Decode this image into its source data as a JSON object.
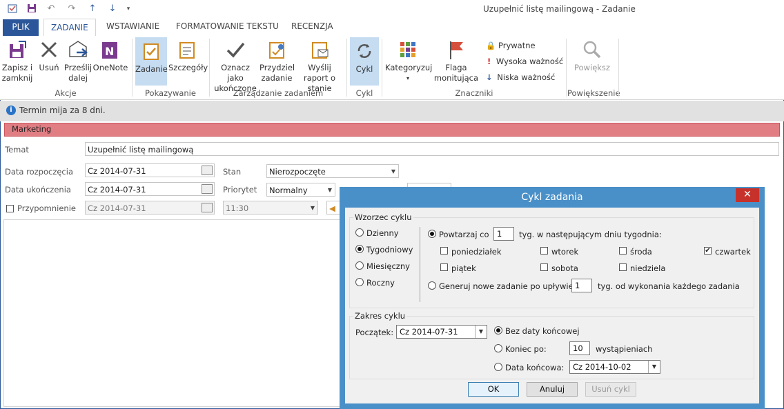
{
  "window": {
    "title": "Uzupełnić listę mailingową - Zadanie"
  },
  "tabs": [
    {
      "label": "PLIK"
    },
    {
      "label": "ZADANIE"
    },
    {
      "label": "WSTAWIANIE"
    },
    {
      "label": "FORMATOWANIE TEKSTU"
    },
    {
      "label": "RECENZJA"
    }
  ],
  "ribbon": {
    "save_close": "Zapisz i zamknij",
    "delete": "Usuń",
    "forward": "Prześlij dalej",
    "onenote": "OneNote",
    "group_actions": "Akcje",
    "task": "Zadanie",
    "details": "Szczegóły",
    "group_show": "Pokazywanie",
    "mark_complete": "Oznacz jako ukończone",
    "assign_task": "Przydziel zadanie",
    "send_status": "Wyślij raport o stanie",
    "group_manage": "Zarządzanie zadaniem",
    "recurrence": "Cykl",
    "group_recurrence": "Cykl",
    "categorize": "Kategoryzuj",
    "follow_up": "Flaga monitująca",
    "private": "Prywatne",
    "high_importance": "Wysoka ważność",
    "low_importance": "Niska ważność",
    "group_tags": "Znaczniki",
    "zoom": "Powiększ",
    "group_zoom": "Powiększenie"
  },
  "infobar": {
    "text": "Termin mija za 8 dni."
  },
  "category": {
    "label": "Marketing",
    "color": "#e17e84"
  },
  "form": {
    "subject_label": "Temat",
    "subject_value": "Uzupełnić listę mailingową",
    "start_label": "Data rozpoczęcia",
    "start_value": "Cz 2014-07-31",
    "due_label": "Data ukończenia",
    "due_value": "Cz 2014-07-31",
    "reminder_label": "Przypomnienie",
    "reminder_date": "Cz 2014-07-31",
    "reminder_time": "11:30",
    "status_label": "Stan",
    "status_value": "Nierozpoczęte",
    "priority_label": "Priorytet",
    "priority_value": "Normalny"
  },
  "dialog": {
    "title": "Cykl zadania",
    "close": "✕",
    "pattern_legend": "Wzorzec cyklu",
    "daily": "Dzienny",
    "weekly": "Tygodniowy",
    "monthly": "Miesięczny",
    "yearly": "Roczny",
    "repeat_every": "Powtarzaj co",
    "repeat_value": "1",
    "repeat_suffix": "tyg. w następującym dniu tygodnia:",
    "days": {
      "mon": "poniedziałek",
      "tue": "wtorek",
      "wed": "środa",
      "thu": "czwartek",
      "fri": "piątek",
      "sat": "sobota",
      "sun": "niedziela"
    },
    "regenerate": "Generuj nowe zadanie po upływie",
    "regenerate_value": "1",
    "regenerate_suffix": "tyg. od wykonania każdego zadania",
    "range_legend": "Zakres cyklu",
    "start_label": "Początek:",
    "start_value": "Cz 2014-07-31",
    "no_end": "Bez daty końcowej",
    "end_after": "Koniec po:",
    "end_after_value": "10",
    "occurrences": "wystąpieniach",
    "end_by": "Data końcowa:",
    "end_by_value": "Cz 2014-10-02",
    "ok": "OK",
    "cancel": "Anuluj",
    "remove": "Usuń cykl"
  }
}
